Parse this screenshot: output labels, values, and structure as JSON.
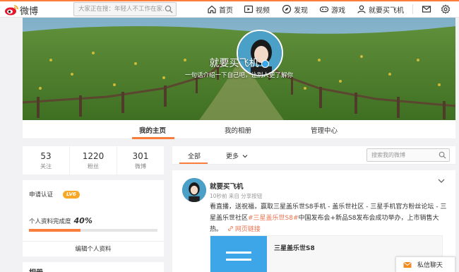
{
  "brand": {
    "name": "微博",
    "accent": "#fa7d3c"
  },
  "search": {
    "placeholder": "大家正在搜：年轻人不工作在家..."
  },
  "nav": {
    "home": "首页",
    "video": "视频",
    "discover": "发现",
    "game": "游戏",
    "user": "就要买飞机"
  },
  "profile": {
    "name": "就要买飞机",
    "bio": "一句话介绍一下自己吧，让别人更了解你"
  },
  "profile_tabs": [
    "我的主页",
    "我的相册",
    "管理中心"
  ],
  "stats": [
    {
      "num": "53",
      "label": "关注"
    },
    {
      "num": "1220",
      "label": "粉丝"
    },
    {
      "num": "301",
      "label": "微博"
    }
  ],
  "info": {
    "cert_label": "申请认证",
    "level": "LV6",
    "complete_label": "个人资料完成度",
    "complete_pct": "40%",
    "complete_value": 0.4,
    "edit_label": "编辑个人资料"
  },
  "album": {
    "title": "相册"
  },
  "feed": {
    "tab_all": "全部",
    "tab_more": "更多",
    "search_placeholder": "搜索我的微博"
  },
  "post": {
    "author": "就要买飞机",
    "meta": "10秒前 来自 分享按钮",
    "text_a": "看直播，送祝福，赢取三星盖乐世S8手机 - 盖乐世社区 - 三星手机官方粉丝论坛 - 三星盖乐世社区",
    "tag": "#三星盖乐世S8#",
    "text_b": "中国发布会+新品S8发布会成功举办，上市销售大热。",
    "link_label": "网页链接",
    "card_title": "三星盖乐世S8"
  },
  "chat": {
    "label": "私信聊天"
  }
}
